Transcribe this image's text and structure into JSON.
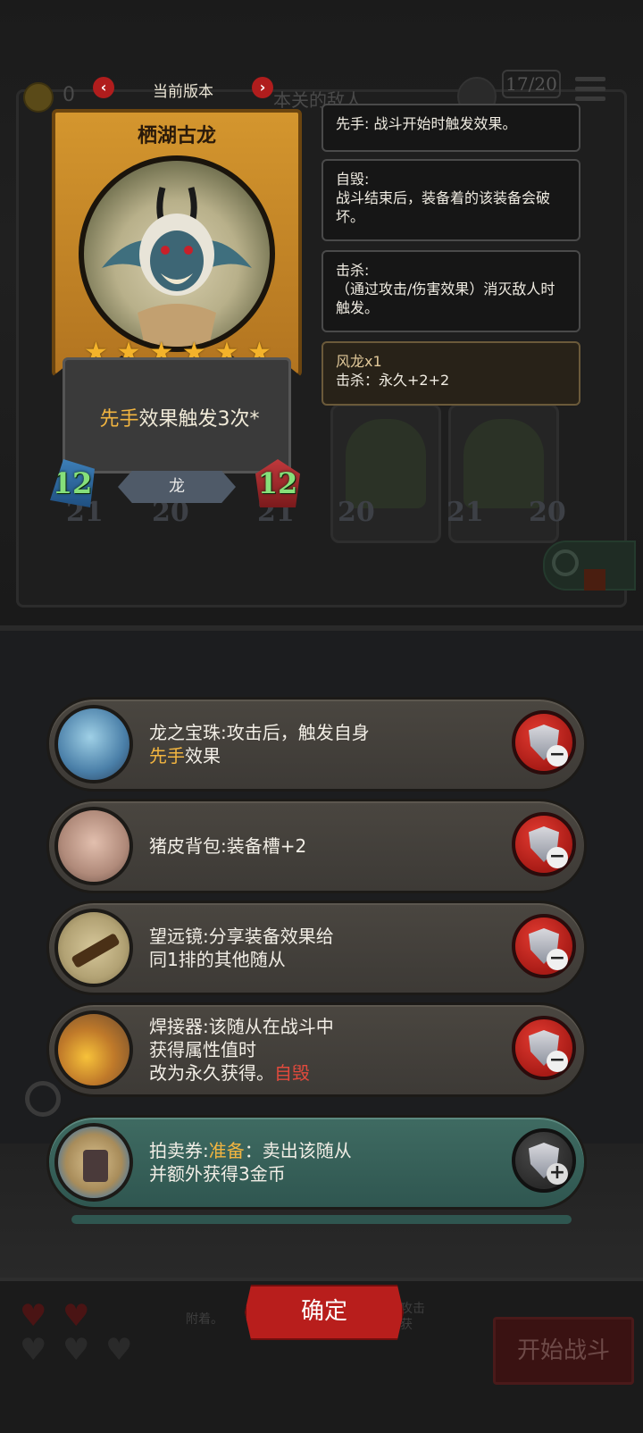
{
  "board": {
    "coins": "0",
    "enemy_label": "本关的敌人",
    "turn": "17/20",
    "units": [
      {
        "atk": "21",
        "hp": "20"
      },
      {
        "atk": "21",
        "hp": "20"
      },
      {
        "atk": "21",
        "hp": "20"
      }
    ]
  },
  "version_selector": {
    "label": "当前版本",
    "prev": "‹",
    "next": "›"
  },
  "card": {
    "name": "栖湖古龙",
    "stars": 6,
    "effect_keyword": "先手",
    "effect_text": "效果触发3次*",
    "type": "龙",
    "attack": "12",
    "health": "12"
  },
  "tooltips": [
    {
      "title": "先手: 战斗开始时触发效果。",
      "body": ""
    },
    {
      "title": "自毁:",
      "body": "战斗结束后，装备着的该装备会破坏。"
    },
    {
      "title": "击杀:",
      "body": "（通过攻击/伤害效果）消灭敌人时触发。"
    },
    {
      "title": "风龙x1",
      "body": "击杀：永久+2+2"
    }
  ],
  "items": [
    {
      "name_text": "龙之宝珠:攻击后，触发自身",
      "line2_kw": "先手",
      "line2_text": "效果",
      "action": "remove"
    },
    {
      "name_text": "猪皮背包:装备槽+2",
      "action": "remove"
    },
    {
      "line1": "望远镜:分享装备效果给",
      "line2": "同1排的其他随从",
      "action": "remove"
    },
    {
      "line1": "焊接器:该随从在战斗中",
      "line2": "获得属性值时",
      "line3_text": "改为永久获得。",
      "line3_warn": "自毁",
      "action": "remove"
    },
    {
      "prefix": "拍卖券:",
      "kw": "准备",
      "suffix": "：卖出该随从",
      "line2": "并额外获得3金币",
      "action": "add"
    }
  ],
  "bottom": {
    "confirm": "确定",
    "start": "开始战斗",
    "dim_1": "附着。",
    "dim_2": "攻击",
    "dim_3": "获"
  },
  "colors": {
    "accent_red": "#b81e1c",
    "keyword_gold": "#f2b540",
    "warn_red": "#e24a3d",
    "gem_green": "#86e07a"
  }
}
